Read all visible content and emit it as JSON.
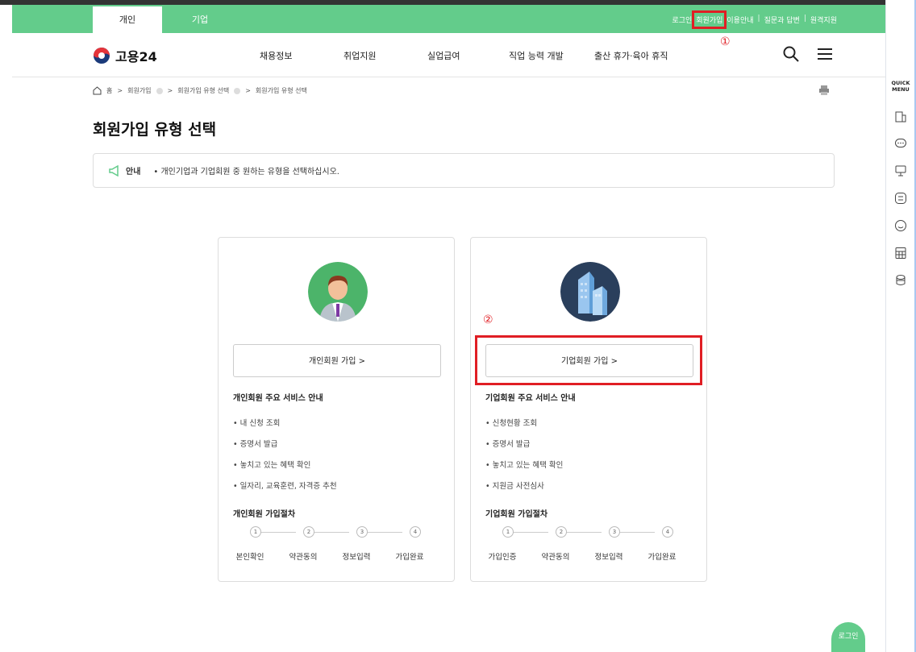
{
  "top_tabs": {
    "personal": "개인",
    "company": "기업"
  },
  "util_links": {
    "login": "로그인",
    "signup": "회원가입",
    "guide": "이용안내",
    "qna": "질문과 답변",
    "remote": "원격지원",
    "sep": "|"
  },
  "annotations": {
    "one": "①",
    "two": "②"
  },
  "logo": {
    "text": "고용24"
  },
  "gnb": [
    "채용정보",
    "취업지원",
    "실업급여",
    "직업 능력 개발",
    "출산 휴가·육아 휴직"
  ],
  "breadcrumb": {
    "home": "홈",
    "arrow": ">",
    "items": [
      "회원가입",
      "회원가입 유형 선택",
      "회원가입 유형 선택"
    ]
  },
  "page_title": "회원가입 유형 선택",
  "notice": {
    "label": "안내",
    "text": "• 개인기업과 기업회원 중 원하는 유형을 선택하십시오."
  },
  "cards": {
    "personal": {
      "button": "개인회원 가입 >",
      "services_title": "개인회원 주요 서비스 안내",
      "services": [
        "• 내 신청 조회",
        "• 증명서 발급",
        "• 놓치고 있는 혜택 확인",
        "• 일자리, 교육훈련, 자격증 추천"
      ],
      "steps_title": "개인회원 가입절차",
      "steps": [
        "본인확인",
        "약관동의",
        "정보입력",
        "가입완료"
      ]
    },
    "company": {
      "button": "기업회원 가입 >",
      "services_title": "기업회원 주요 서비스 안내",
      "services": [
        "• 신청현황 조회",
        "• 증명서 발급",
        "• 놓치고 있는 혜택 확인",
        "• 지원금 사전심사"
      ],
      "steps_title": "기업회원 가입절차",
      "steps": [
        "가입인증",
        "약관동의",
        "정보입력",
        "가입완료"
      ]
    }
  },
  "step_numbers": [
    "1",
    "2",
    "3",
    "4"
  ],
  "quick_menu": {
    "label_1": "QUICK",
    "label_2": "MENU"
  },
  "fab_login": "로그인",
  "colors": {
    "brand_green": "#63cc8b",
    "highlight_red": "#e01e24"
  }
}
